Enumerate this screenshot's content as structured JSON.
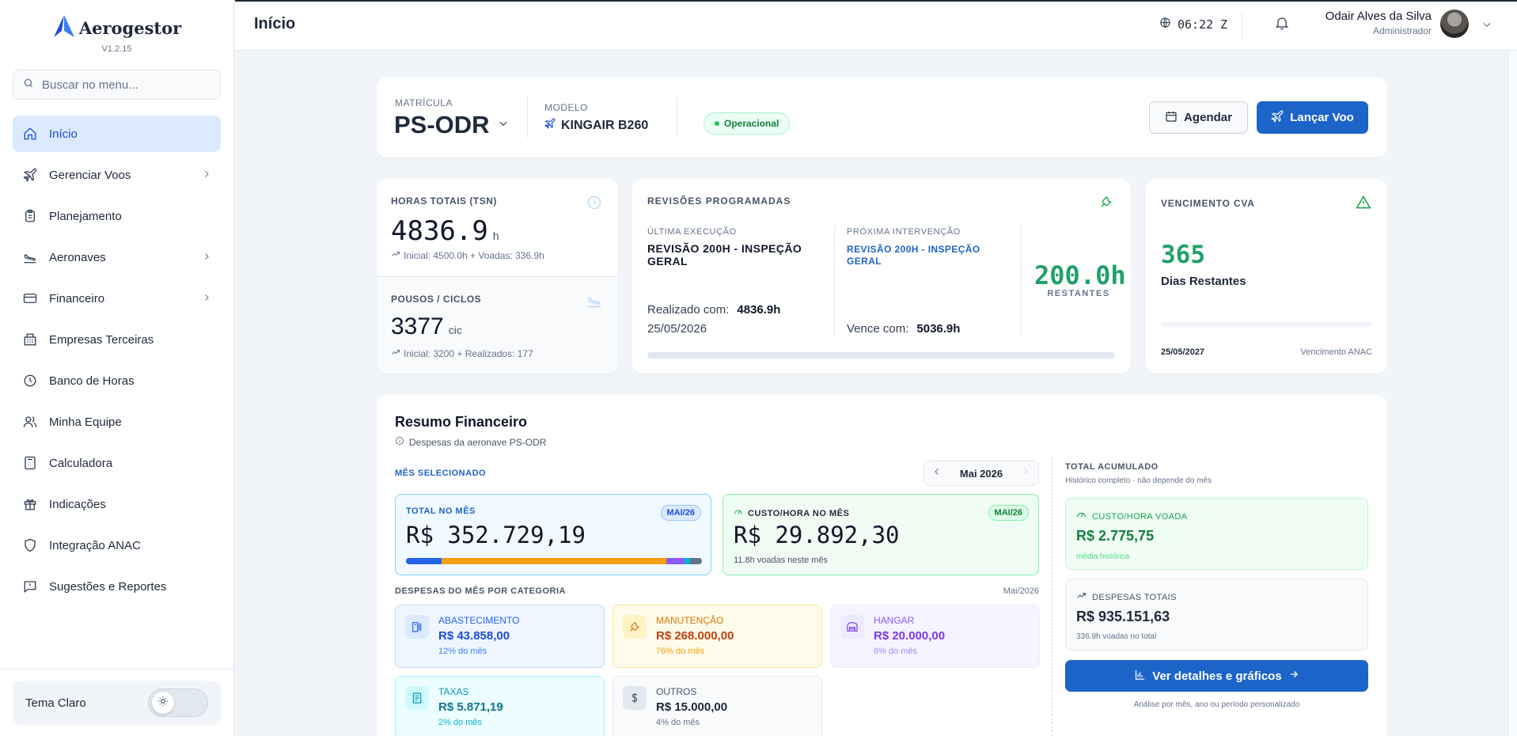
{
  "app": {
    "name": "Aerogestor",
    "version": "V1.2.15"
  },
  "sidebar": {
    "search_placeholder": "Buscar no menu...",
    "items": [
      {
        "label": "Início",
        "icon": "home-icon"
      },
      {
        "label": "Gerenciar Voos",
        "icon": "plane-icon"
      },
      {
        "label": "Planejamento",
        "icon": "clipboard-icon"
      },
      {
        "label": "Aeronaves",
        "icon": "plane-landing-icon"
      },
      {
        "label": "Financeiro",
        "icon": "credit-card-icon"
      },
      {
        "label": "Empresas Terceiras",
        "icon": "building-icon"
      },
      {
        "label": "Banco de Horas",
        "icon": "clock-icon"
      },
      {
        "label": "Minha Equipe",
        "icon": "users-icon"
      },
      {
        "label": "Calculadora",
        "icon": "calculator-icon"
      },
      {
        "label": "Indicações",
        "icon": "gift-icon"
      },
      {
        "label": "Integração ANAC",
        "icon": "shield-icon"
      },
      {
        "label": "Sugestões e Reportes",
        "icon": "message-alert-icon"
      }
    ],
    "theme_label": "Tema Claro"
  },
  "header": {
    "title": "Início",
    "clock": "06:22 Z",
    "user_name": "Odair Alves da Silva",
    "user_role": "Administrador"
  },
  "aircraft": {
    "matricula_label": "MATRÍCULA",
    "matricula": "PS-ODR",
    "modelo_label": "MODELO",
    "modelo": "KINGAIR B260",
    "status": "Operacional",
    "agendar_label": "Agendar",
    "lancar_label": "Lançar Voo"
  },
  "hours": {
    "label": "HORAS TOTAIS (TSN)",
    "value": "4836.9",
    "unit": "h",
    "sub": "Inicial: 4500.0h + Voadas: 336.9h"
  },
  "landings": {
    "label": "POUSOS / CICLOS",
    "value": "3377",
    "unit": "cic",
    "sub": "Inicial: 3200 + Realizados: 177"
  },
  "revisions": {
    "title": "REVISÕES PROGRAMADAS",
    "last_label": "ÚLTIMA EXECUÇÃO",
    "last_name": "REVISÃO 200H - INSPEÇÃO GERAL",
    "done_label": "Realizado com:",
    "done_value": "4836.9h",
    "done_date": "25/05/2026",
    "next_label": "PRÓXIMA INTERVENÇÃO",
    "next_name": "REVISÃO 200H - INSPEÇÃO GERAL",
    "due_label": "Vence com:",
    "due_value": "5036.9h",
    "remaining": "200.0h",
    "remaining_label": "RESTANTES",
    "progress": 0.0
  },
  "cva": {
    "title": "VENCIMENTO CVA",
    "days": "365",
    "days_label": "Dias Restantes",
    "date": "25/05/2027",
    "note": "Vencimento ANAC",
    "progress": 0.0
  },
  "finance": {
    "title": "Resumo Financeiro",
    "subtitle": "Despesas da aeronave PS-ODR",
    "month_selected_label": "MÊS SELECIONADO",
    "month": "Mai 2026",
    "total_month_label": "TOTAL NO MÊS",
    "total_month_badge": "MAI/26",
    "total_month": "R$ 352.729,19",
    "cost_hour_label": "CUSTO/HORA NO MÊS",
    "cost_hour_badge": "MAI/26",
    "cost_hour": "R$ 29.892,30",
    "cost_hour_sub": "11.8h voadas neste mês",
    "categories_label": "DESPESAS DO MÊS POR CATEGORIA",
    "categories_month": "Mai/2026",
    "categories": [
      {
        "name": "ABASTECIMENTO",
        "value": "R$ 43.858,00",
        "pct": "12% do mês",
        "icon": "fuel-icon",
        "color": "#2563eb"
      },
      {
        "name": "MANUTENÇÃO",
        "value": "R$ 268.000,00",
        "pct": "76% do mês",
        "icon": "wrench-icon",
        "color": "#f59e0b"
      },
      {
        "name": "HANGAR",
        "value": "R$ 20.000,00",
        "pct": "6% do mês",
        "icon": "hangar-icon",
        "color": "#8b5cf6"
      },
      {
        "name": "TAXAS",
        "value": "R$ 5.871,19",
        "pct": "2% do mês",
        "icon": "document-icon",
        "color": "#06b6d4"
      },
      {
        "name": "OUTROS",
        "value": "R$ 15.000,00",
        "pct": "4% do mês",
        "icon": "dollar-icon",
        "color": "#64748b"
      }
    ],
    "acc_title": "TOTAL ACUMULADO",
    "acc_sub": "Histórico completo · não depende do mês",
    "acc_cost_label": "CUSTO/HORA VOADA",
    "acc_cost": "R$ 2.775,75",
    "acc_cost_sub": "média histórica",
    "acc_total_label": "DESPESAS TOTAIS",
    "acc_total": "R$ 935.151,63",
    "acc_total_sub": "336.9h voadas no total",
    "details_label": "Ver detalhes e gráficos",
    "details_sub": "Análise por mês, ano ou período personalizado"
  }
}
